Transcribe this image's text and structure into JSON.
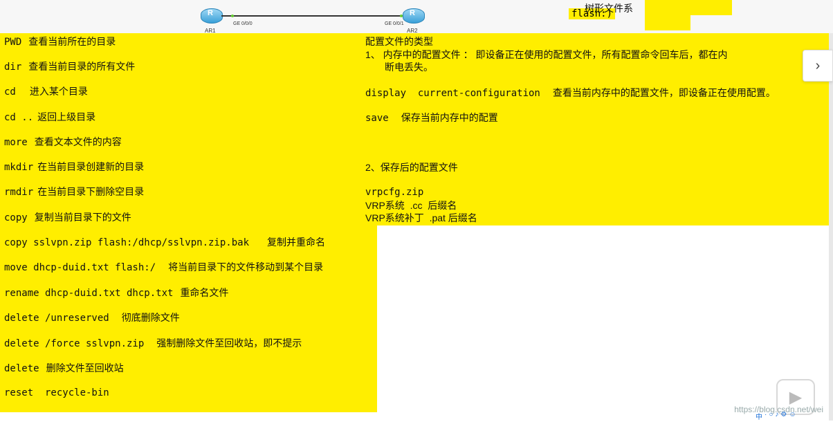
{
  "topology": {
    "router1_label": "AR1",
    "router2_label": "AR2",
    "port_left": "GE 0/0/0",
    "port_right": "GE 0/0/1",
    "router_glyph": "R",
    "note_tree": "树形文件系",
    "note_flash": "flash:)"
  },
  "left_commands": [
    {
      "cmd": "PWD",
      "desc": "查看当前所在的目录"
    },
    {
      "cmd": "dir",
      "desc": "查看当前目录的所有文件"
    },
    {
      "cmd": "cd",
      "desc": "进入某个目录"
    },
    {
      "cmd": "cd ..",
      "desc": "返回上级目录"
    },
    {
      "cmd": "more",
      "desc": "查看文本文件的内容"
    },
    {
      "cmd": "mkdir",
      "desc": "在当前目录创建新的目录"
    },
    {
      "cmd": "rmdir",
      "desc": "在当前目录下删除空目录"
    },
    {
      "cmd": "copy",
      "desc": "复制当前目录下的文件"
    },
    {
      "cmd": "copy sslvpn.zip flash:/dhcp/sslvpn.zip.bak",
      "desc": "复制并重命名"
    },
    {
      "cmd": "move dhcp-duid.txt flash:/",
      "desc": "将当前目录下的文件移动到某个目录"
    },
    {
      "cmd": "rename dhcp-duid.txt dhcp.txt",
      "desc": "重命名文件"
    },
    {
      "cmd": "delete /unreserved",
      "desc": "彻底删除文件"
    },
    {
      "cmd": "delete /force sslvpn.zip",
      "desc": "强制删除文件至回收站，即不提示"
    },
    {
      "cmd": "delete",
      "desc": "删除文件至回收站"
    },
    {
      "cmd": "reset  recycle-bin",
      "desc": ""
    }
  ],
  "right": {
    "title": "配置文件的类型",
    "item1_line1": "1、 内存中的配置文件 ： 即设备正在使用的配置文件，所有配置命令回车后，都在内",
    "item1_line2": "断电丢失。",
    "display_cmd": "display  current-configuration",
    "display_desc": "查看当前内存中的配置文件，即设备正在使用配置。",
    "save_cmd": "save",
    "save_desc": "保存当前内存中的配置",
    "item2": "2、保存后的配置文件",
    "vrpcfg": "vrpcfg.zip",
    "vrp_line": "VRP系统  .cc  后缀名",
    "vrp_patch_line": "VRP系统补丁  .pat 后缀名"
  },
  "controls": {
    "next_icon": "›",
    "watermark": "https://blog.csdn.net/wei",
    "play_icon": "▶",
    "tray": [
      "中",
      "·",
      "○",
      "♪",
      "⚙",
      "☺"
    ]
  },
  "colors": {
    "highlight": "#ffee00"
  }
}
